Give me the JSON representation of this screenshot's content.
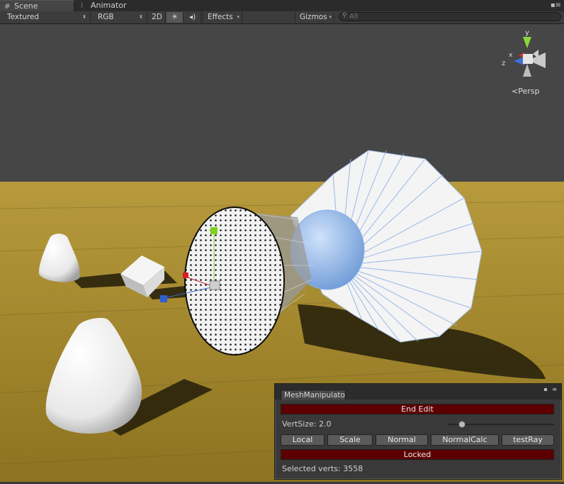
{
  "tabs": [
    {
      "label": "Scene",
      "icon": "scene-grid-icon",
      "active": true
    },
    {
      "label": "Animator",
      "icon": "animator-icon",
      "active": false
    }
  ],
  "toolbar": {
    "render_mode": "Textured",
    "color_mode": "RGB",
    "mode_2d": "2D",
    "lighting_icon": "sun-icon",
    "audio_icon": "speaker-icon",
    "effects": "Effects",
    "gizmos": "Gizmos",
    "search_placeholder": "All"
  },
  "orientation_gizmo": {
    "axis_y": "y",
    "axis_z": "z",
    "projection": "Persp",
    "colors": {
      "x": "#d6332c",
      "y": "#8ed43b",
      "z": "#3f6ed6"
    }
  },
  "mesh_panel": {
    "title": "MeshManipulato",
    "end_edit": "End Edit",
    "vert_size_label": "VertSize: 2.0",
    "vert_size_value": 2.0,
    "slider_fraction": 0.13,
    "buttons": [
      "Local",
      "Scale",
      "Normal",
      "NormalCalc",
      "testRay"
    ],
    "locked": "Locked",
    "selected_verts_label": "Selected verts: 3558",
    "accent_red": "#5e0000"
  }
}
